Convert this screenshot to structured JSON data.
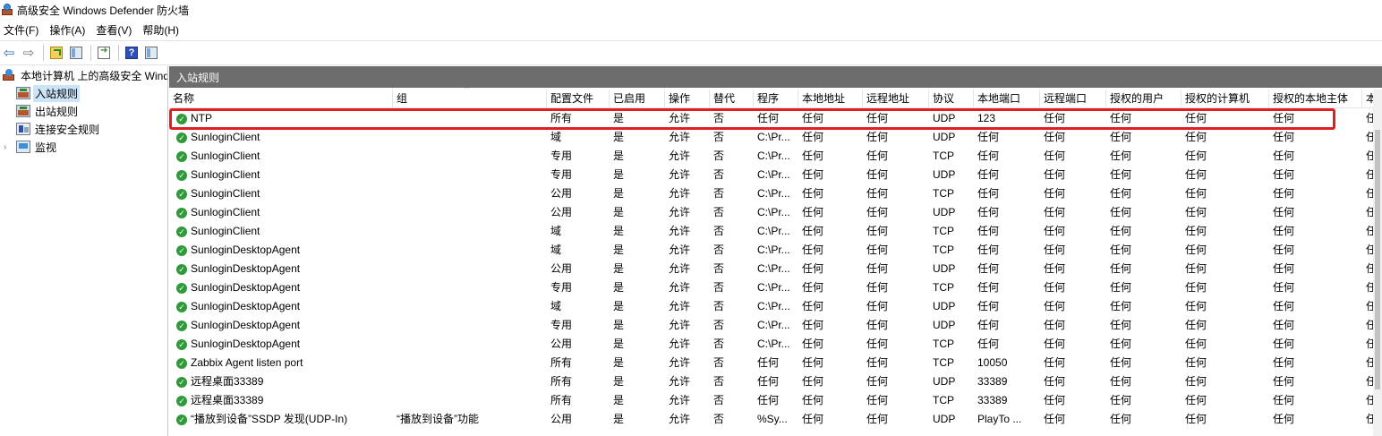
{
  "window": {
    "title": "高级安全 Windows Defender 防火墙"
  },
  "menu": [
    "文件(F)",
    "操作(A)",
    "查看(V)",
    "帮助(H)"
  ],
  "toolbar": {
    "icons": [
      "back-arrow-icon",
      "forward-arrow-icon",
      "up-folder-icon",
      "show-hide-tree-icon",
      "export-list-icon",
      "help-icon",
      "show-hide-action-pane-icon"
    ],
    "back_glyph": "⇦",
    "forward_glyph": "⇨",
    "help_glyph": "?"
  },
  "tree": {
    "root": "本地计算机 上的高级安全 Windows Defender 防火墙",
    "root_display": "本地计算机 上的高级安全 Wind",
    "inbound": "入站规则",
    "outbound": "出站规则",
    "connection_security": "连接安全规则",
    "monitor": "监视",
    "expander_glyph": "›"
  },
  "pane": {
    "title": "入站规则",
    "sort_glyph": "^",
    "columns": [
      "名称",
      "组",
      "配置文件",
      "已启用",
      "操作",
      "替代",
      "程序",
      "本地地址",
      "远程地址",
      "协议",
      "本地端口",
      "远程端口",
      "授权的用户",
      "授权的计算机",
      "授权的本地主体",
      "本"
    ],
    "rows": [
      [
        "NTP",
        "",
        "所有",
        "是",
        "允许",
        "否",
        "任何",
        "任何",
        "任何",
        "UDP",
        "123",
        "任何",
        "任何",
        "任何",
        "任何",
        "任"
      ],
      [
        "SunloginClient",
        "",
        "域",
        "是",
        "允许",
        "否",
        "C:\\Pr...",
        "任何",
        "任何",
        "UDP",
        "任何",
        "任何",
        "任何",
        "任何",
        "任何",
        "任"
      ],
      [
        "SunloginClient",
        "",
        "专用",
        "是",
        "允许",
        "否",
        "C:\\Pr...",
        "任何",
        "任何",
        "TCP",
        "任何",
        "任何",
        "任何",
        "任何",
        "任何",
        "任"
      ],
      [
        "SunloginClient",
        "",
        "专用",
        "是",
        "允许",
        "否",
        "C:\\Pr...",
        "任何",
        "任何",
        "UDP",
        "任何",
        "任何",
        "任何",
        "任何",
        "任何",
        "任"
      ],
      [
        "SunloginClient",
        "",
        "公用",
        "是",
        "允许",
        "否",
        "C:\\Pr...",
        "任何",
        "任何",
        "TCP",
        "任何",
        "任何",
        "任何",
        "任何",
        "任何",
        "任"
      ],
      [
        "SunloginClient",
        "",
        "公用",
        "是",
        "允许",
        "否",
        "C:\\Pr...",
        "任何",
        "任何",
        "UDP",
        "任何",
        "任何",
        "任何",
        "任何",
        "任何",
        "任"
      ],
      [
        "SunloginClient",
        "",
        "域",
        "是",
        "允许",
        "否",
        "C:\\Pr...",
        "任何",
        "任何",
        "TCP",
        "任何",
        "任何",
        "任何",
        "任何",
        "任何",
        "任"
      ],
      [
        "SunloginDesktopAgent",
        "",
        "域",
        "是",
        "允许",
        "否",
        "C:\\Pr...",
        "任何",
        "任何",
        "TCP",
        "任何",
        "任何",
        "任何",
        "任何",
        "任何",
        "任"
      ],
      [
        "SunloginDesktopAgent",
        "",
        "公用",
        "是",
        "允许",
        "否",
        "C:\\Pr...",
        "任何",
        "任何",
        "UDP",
        "任何",
        "任何",
        "任何",
        "任何",
        "任何",
        "任"
      ],
      [
        "SunloginDesktopAgent",
        "",
        "专用",
        "是",
        "允许",
        "否",
        "C:\\Pr...",
        "任何",
        "任何",
        "TCP",
        "任何",
        "任何",
        "任何",
        "任何",
        "任何",
        "任"
      ],
      [
        "SunloginDesktopAgent",
        "",
        "域",
        "是",
        "允许",
        "否",
        "C:\\Pr...",
        "任何",
        "任何",
        "UDP",
        "任何",
        "任何",
        "任何",
        "任何",
        "任何",
        "任"
      ],
      [
        "SunloginDesktopAgent",
        "",
        "专用",
        "是",
        "允许",
        "否",
        "C:\\Pr...",
        "任何",
        "任何",
        "UDP",
        "任何",
        "任何",
        "任何",
        "任何",
        "任何",
        "任"
      ],
      [
        "SunloginDesktopAgent",
        "",
        "公用",
        "是",
        "允许",
        "否",
        "C:\\Pr...",
        "任何",
        "任何",
        "TCP",
        "任何",
        "任何",
        "任何",
        "任何",
        "任何",
        "任"
      ],
      [
        "Zabbix Agent listen port",
        "",
        "所有",
        "是",
        "允许",
        "否",
        "任何",
        "任何",
        "任何",
        "TCP",
        "10050",
        "任何",
        "任何",
        "任何",
        "任何",
        "任"
      ],
      [
        "远程桌面33389",
        "",
        "所有",
        "是",
        "允许",
        "否",
        "任何",
        "任何",
        "任何",
        "UDP",
        "33389",
        "任何",
        "任何",
        "任何",
        "任何",
        "任"
      ],
      [
        "远程桌面33389",
        "",
        "所有",
        "是",
        "允许",
        "否",
        "任何",
        "任何",
        "任何",
        "TCP",
        "33389",
        "任何",
        "任何",
        "任何",
        "任何",
        "任"
      ],
      [
        "“播放到设备”SSDP 发现(UDP-In)",
        "“播放到设备”功能",
        "公用",
        "是",
        "允许",
        "否",
        "%Sy...",
        "任何",
        "任何",
        "UDP",
        "PlayTo ...",
        "任何",
        "任何",
        "任何",
        "任何",
        "任"
      ]
    ],
    "enabled_icon": "green-check-icon",
    "enabled_glyph": "✓",
    "highlight_color": "#e02020"
  }
}
